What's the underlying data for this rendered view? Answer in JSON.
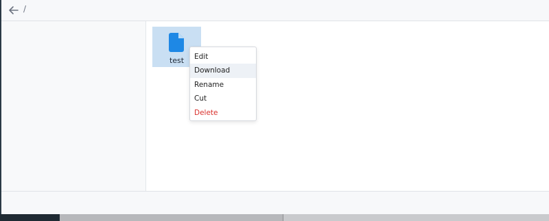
{
  "header": {
    "back_icon": "arrow-left-icon",
    "breadcrumb": "/"
  },
  "files": [
    {
      "name": "test",
      "icon": "document-icon",
      "selected": true
    }
  ],
  "context_menu": {
    "items": [
      {
        "label": "Edit"
      },
      {
        "label": "Download",
        "state": "hovered"
      },
      {
        "label": "Rename"
      },
      {
        "label": "Cut"
      },
      {
        "label": "Delete",
        "style": "danger"
      }
    ]
  },
  "colors": {
    "accent": "#1e88e5",
    "selection": "#c9dff3",
    "danger": "#d9302c",
    "hover": "#edf1f6"
  }
}
